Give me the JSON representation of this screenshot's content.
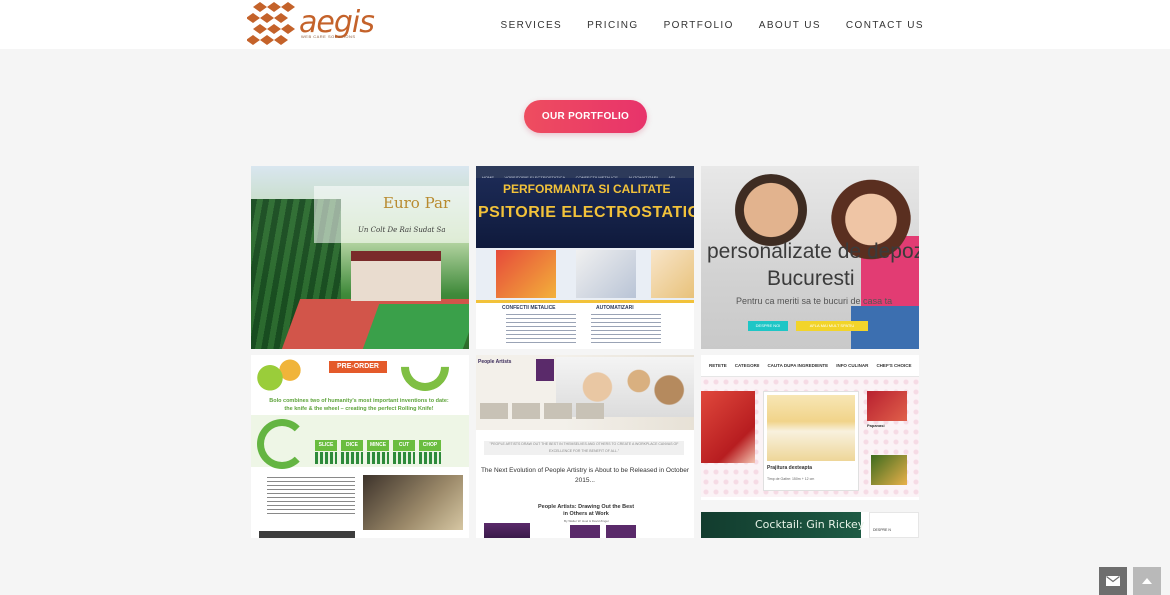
{
  "header": {
    "logo_word": "aegis",
    "logo_tagline": "web care solutions",
    "nav": [
      "SERVICES",
      "PRICING",
      "PORTFOLIO",
      "ABOUT US",
      "CONTACT US"
    ]
  },
  "cta": {
    "label": "OUR PORTFOLIO"
  },
  "portfolio": {
    "tile1": {
      "brand": "Euro Par",
      "slogan": "Un Colt De Rai Sudat Sa"
    },
    "tile2": {
      "nav": [
        "HOME",
        "VOPSITORIE ELECTROSTATICA",
        "CONFECTII METALICE",
        "AUTOMATIZARI",
        "ARL - LAMINARE DE MARE PRESIUNE"
      ],
      "headline": "PERFORMANTA SI CALITATE",
      "banner": "PSITORIE ELECTROSTATIC",
      "labels": [
        "CONFECTII METALICE",
        "AUTOMATIZARI"
      ]
    },
    "tile3": {
      "title1": "personalizate de depozi",
      "title2": "Bucuresti",
      "sub": "Pentru ca meriti sa te bucuri de casa ta",
      "btn1": "DESPRE NOI",
      "btn2": "AFLA MAI MULT SPATIU"
    },
    "tile4": {
      "banner": "PRE-ORDER",
      "text": "Bolo combines two of humanity's most important inventions to date: the knife & the wheel – creating the perfect Rolling Knife!",
      "chips": [
        "SLICE",
        "DICE",
        "MINCE",
        "CUT",
        "CHOP"
      ]
    },
    "tile5": {
      "hero_title": "People Artists",
      "quote": "\"PEOPLE ARTISTS DRAW OUT THE BEST IN THEMSELVES AND OTHERS TO CREATE A WORKPLACE CANVAS OF EXCELLENCE FOR THE BENEFIT OF ALL.\"",
      "news": "The Next Evolution of People Artistry is About to be Released in October 2015...",
      "book_title": "People Artists: Drawing Out the Best in Others at Work",
      "authors": "By Walter W. Hoel & David Zinger"
    },
    "tile6": {
      "menu": [
        "RETETE",
        "CATEGORII",
        "CAUTA DUPA INGREDIENTE",
        "INFO CULINAR",
        "CHEF'S CHOICE"
      ],
      "card_title": "Prajitura dexteapta",
      "card_info": "Timp de Gatire: 150m + 12 cm",
      "side_title": "Papanasi",
      "bar_title": "Cocktail: Gin Rickey",
      "despre": "DESPRE N"
    }
  },
  "colors": {
    "accent": "#e8336b",
    "accent_start": "#ee4d5f",
    "logo": "#c4622a",
    "fab_dark": "#6e6e6e",
    "fab_light": "#b9b9b9"
  },
  "icons": {
    "logo": "diamond-grid-logo-icon",
    "contact": "envelope-icon",
    "top": "chevron-up-icon"
  }
}
